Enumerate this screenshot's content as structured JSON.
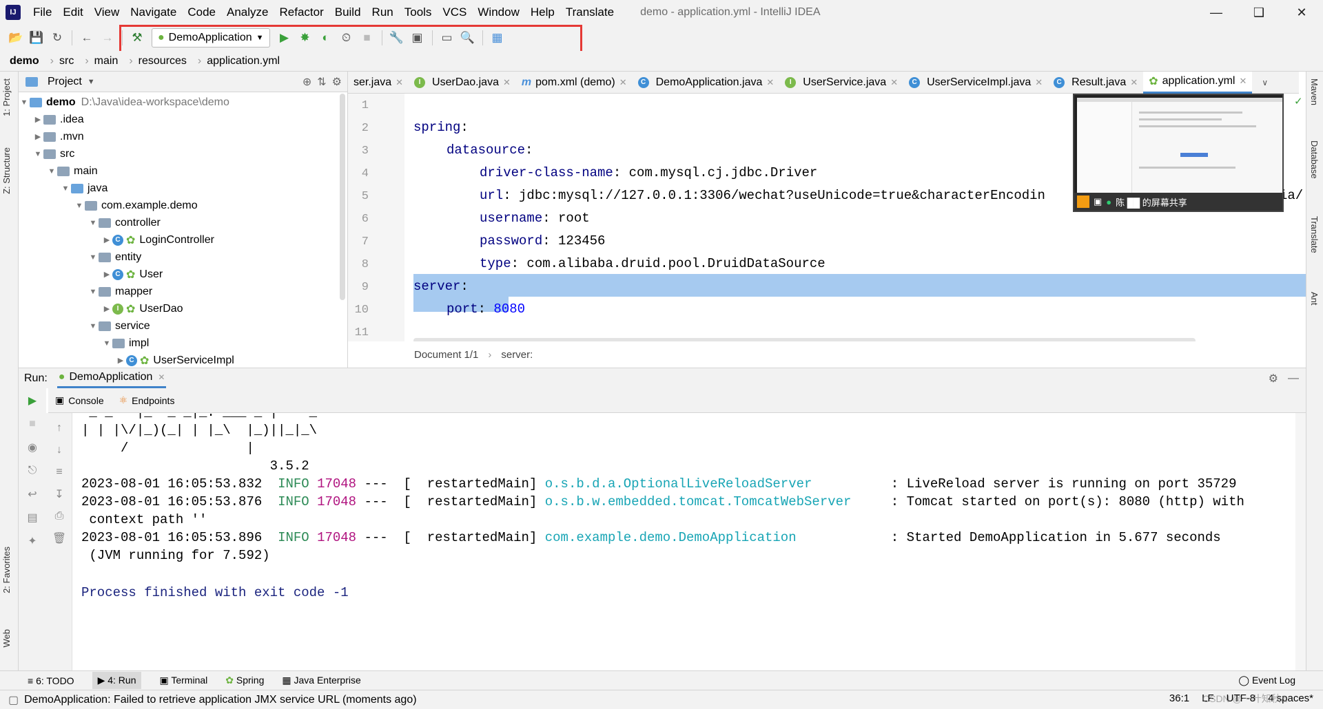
{
  "menubar": {
    "items": [
      "File",
      "Edit",
      "View",
      "Navigate",
      "Code",
      "Analyze",
      "Refactor",
      "Build",
      "Run",
      "Tools",
      "VCS",
      "Window",
      "Help",
      "Translate"
    ],
    "window_title": "demo - application.yml - IntelliJ IDEA"
  },
  "toolbar": {
    "run_config": "DemoApplication"
  },
  "breadcrumb": [
    "demo",
    "src",
    "main",
    "resources",
    "application.yml"
  ],
  "project": {
    "header": "Project",
    "root_name": "demo",
    "root_path": "D:\\Java\\idea-workspace\\demo",
    "tree": [
      ".idea",
      ".mvn",
      "src",
      "main",
      "java",
      "com.example.demo",
      "controller",
      "LoginController",
      "entity",
      "User",
      "mapper",
      "UserDao",
      "service",
      "impl",
      "UserServiceImpl"
    ]
  },
  "editor": {
    "tabs": [
      "ser.java",
      "UserDao.java",
      "pom.xml (demo)",
      "DemoApplication.java",
      "UserService.java",
      "UserServiceImpl.java",
      "Result.java",
      "application.yml"
    ],
    "line_numbers": [
      "1",
      "2",
      "3",
      "4",
      "5",
      "6",
      "7",
      "8",
      "9",
      "10",
      "11"
    ],
    "lines": {
      "l2_key": "spring",
      "l3_key": "datasource",
      "l4_key": "driver-class-name",
      "l4_val": "com.mysql.cj.jdbc.Driver",
      "l5_key": "url",
      "l5_val": "jdbc:mysql://127.0.0.1:3306/wechat?useUnicode=true&characterEncodin",
      "l5_tail": "ia/",
      "l6_key": "username",
      "l6_val": "root",
      "l7_key": "password",
      "l7_val": "123456",
      "l8_key": "type",
      "l8_val": "com.alibaba.druid.pool.DruidDataSource",
      "l9_key": "server",
      "l10_key": "port",
      "l10_val": "8080"
    },
    "status_doc": "Document 1/1",
    "status_path": "server:"
  },
  "share_overlay": {
    "label": "陈 ██ 的屏幕共享"
  },
  "right_tabs": [
    "Maven",
    "Database",
    "Translate",
    "Ant"
  ],
  "left_tabs": [
    "1: Project",
    "Z: Structure",
    "2: Favorites",
    "Web"
  ],
  "run": {
    "label": "Run:",
    "config": "DemoApplication",
    "tabs": [
      "Console",
      "Endpoints"
    ],
    "banner": [
      " _ _   |_  _ _|_. ___ _ |    _",
      "| | |\\/|_)(_| | |_\\  |_)||_|_\\",
      "     /               |",
      "                        3.5.2"
    ],
    "log": [
      {
        "time": "2023-08-01 16:05:53.832",
        "level": "INFO",
        "pid": "17048",
        "thread": "---  [  restartedMain]",
        "logger": "o.s.b.d.a.OptionalLiveReloadServer",
        "msg": "  : LiveReload server is running on port 35729"
      },
      {
        "time": "2023-08-01 16:05:53.876",
        "level": "INFO",
        "pid": "17048",
        "thread": "---  [  restartedMain]",
        "logger": "o.s.b.w.embedded.tomcat.TomcatWebServer",
        "msg": "  : Tomcat started on port(s): 8080 (http) with"
      },
      {
        "time": "2023-08-01 16:05:53.896",
        "level": "INFO",
        "pid": "17048",
        "thread": "---  [  restartedMain]",
        "logger": "com.example.demo.DemoApplication",
        "msg": "  : Started DemoApplication in 5.677 seconds"
      }
    ],
    "cont1": " context path ''",
    "cont3": " (JVM running for 7.592)",
    "finished": "Process finished with exit code -1"
  },
  "tool_tabs": [
    "6: TODO",
    "4: Run",
    "Terminal",
    "Spring",
    "Java Enterprise"
  ],
  "event_log": "Event Log",
  "status": {
    "message": "DemoApplication: Failed to retrieve application JMX service URL (moments ago)",
    "position": "36:1",
    "line_sep": "LF",
    "encoding": "UTF-8",
    "indent": "4 spaces*",
    "watermark": "CSDN @一叶知秋&"
  },
  "colors": {
    "highlight": "#e53935",
    "selection": "#a6caf0",
    "accent": "#4083c9"
  }
}
